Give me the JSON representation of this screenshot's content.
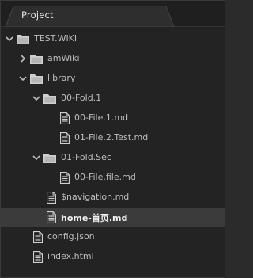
{
  "panel": {
    "tab_title": "Project"
  },
  "tree": [
    {
      "label": "TEST.WIKI",
      "kind": "folder",
      "expanded": true,
      "level": 0,
      "name": "tree-root-test-wiki"
    },
    {
      "label": "amWiki",
      "kind": "folder",
      "expanded": false,
      "level": 1,
      "name": "tree-folder-amwiki"
    },
    {
      "label": "library",
      "kind": "folder",
      "expanded": true,
      "level": 1,
      "name": "tree-folder-library"
    },
    {
      "label": "00-Fold.1",
      "kind": "folder",
      "expanded": true,
      "level": 2,
      "name": "tree-folder-00-fold-1"
    },
    {
      "label": "00-File.1.md",
      "kind": "file",
      "level": 3,
      "name": "tree-file-00-file-1"
    },
    {
      "label": "01-File.2.Test.md",
      "kind": "file",
      "level": 3,
      "name": "tree-file-01-file-2-test"
    },
    {
      "label": "01-Fold.Sec",
      "kind": "folder",
      "expanded": true,
      "level": 2,
      "name": "tree-folder-01-fold-sec"
    },
    {
      "label": "00-File.file.md",
      "kind": "file",
      "level": 3,
      "name": "tree-file-00-file-file"
    },
    {
      "label": "$navigation.md",
      "kind": "file",
      "level": 2,
      "name": "tree-file-navigation"
    },
    {
      "label": "home-首页.md",
      "kind": "file",
      "level": 2,
      "selected": true,
      "name": "tree-file-home"
    },
    {
      "label": "config.json",
      "kind": "file",
      "level": 1,
      "name": "tree-file-config-json"
    },
    {
      "label": "index.html",
      "kind": "file",
      "level": 1,
      "name": "tree-file-index-html"
    }
  ],
  "colors": {
    "background": "#232323",
    "selected_row": "#3b3b3b",
    "text": "#bdbdbd",
    "icon": "#cfcfcf"
  }
}
